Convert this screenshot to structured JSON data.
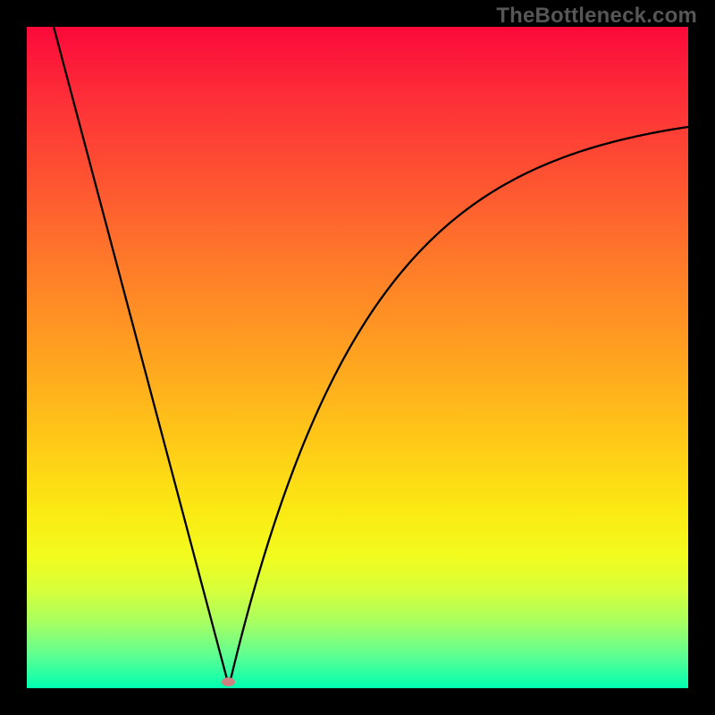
{
  "watermark": "TheBottleneck.com",
  "chart_data": {
    "type": "line",
    "title": "",
    "xlabel": "",
    "ylabel": "",
    "xlim": [
      0,
      100
    ],
    "ylim": [
      0,
      100
    ],
    "vertex_x": 30.5,
    "left": {
      "comment": "Near-linear descending branch from top-left to vertex",
      "x": [
        3.0,
        30.5
      ],
      "y": [
        104.0,
        0.5
      ]
    },
    "right": {
      "comment": "Asymptotic rising branch from vertex toward ~83 at right edge",
      "asymptote": 88.0,
      "rate": 0.048,
      "x_start": 30.5,
      "x_end": 100.0
    },
    "marker": {
      "x": 30.5,
      "y": 0.9,
      "color": "#ce8181"
    },
    "gradient_stops": [
      {
        "p": 0,
        "c": "#fb093a"
      },
      {
        "p": 10,
        "c": "#fd2c38"
      },
      {
        "p": 22,
        "c": "#fe5032"
      },
      {
        "p": 35,
        "c": "#ff782a"
      },
      {
        "p": 50,
        "c": "#ffa320"
      },
      {
        "p": 63,
        "c": "#ffca17"
      },
      {
        "p": 73,
        "c": "#fbe913"
      },
      {
        "p": 80,
        "c": "#f2fb1e"
      },
      {
        "p": 85,
        "c": "#d8ff3a"
      },
      {
        "p": 90,
        "c": "#a8ff60"
      },
      {
        "p": 95,
        "c": "#5fff92"
      },
      {
        "p": 100,
        "c": "#00ffb0"
      }
    ]
  }
}
